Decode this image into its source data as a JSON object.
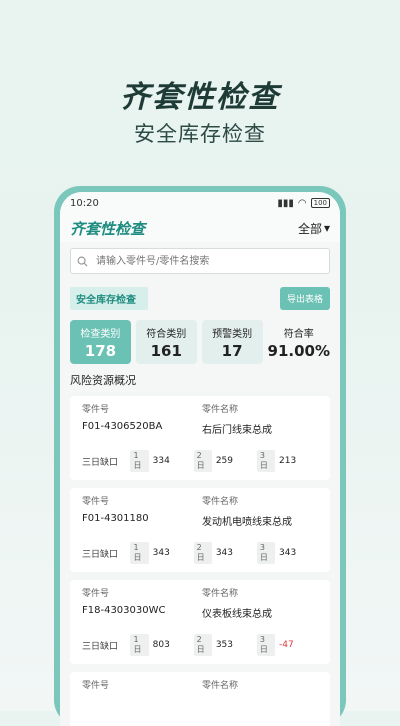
{
  "promo": {
    "title": "齐套性检查",
    "subtitle": "安全库存检查"
  },
  "status_bar": {
    "time": "10:20",
    "left_icons": "⚐ ⚐ ✱",
    "battery": "100"
  },
  "header": {
    "title": "齐套性检查",
    "filter": "全部"
  },
  "search": {
    "placeholder": "请输入零件号/零件名搜索"
  },
  "section": {
    "label": "安全库存检查",
    "export_label": "导出表格"
  },
  "stats": [
    {
      "label": "检查类别",
      "value": "178"
    },
    {
      "label": "符合类别",
      "value": "161"
    },
    {
      "label": "预警类别",
      "value": "17"
    },
    {
      "label": "符合率",
      "value": "91.00%"
    }
  ],
  "risk_title": "风险资源概况",
  "labels": {
    "part_no": "零件号",
    "part_name": "零件名称"
  },
  "cards": [
    {
      "part_no": "F01-4306520BA",
      "part_name": "右后门线束总成",
      "main": "三日缺口",
      "d1_tag": "1日",
      "d1": "334",
      "d2_tag": "2日",
      "d2": "259",
      "d3_tag": "3日",
      "d3": "213"
    },
    {
      "part_no": "F01-4301180",
      "part_name": "发动机电喷线束总成",
      "main": "三日缺口",
      "d1_tag": "1日",
      "d1": "343",
      "d2_tag": "2日",
      "d2": "343",
      "d3_tag": "3日",
      "d3": "343"
    },
    {
      "part_no": "F18-4303030WC",
      "part_name": "仪表板线束总成",
      "main": "三日缺口",
      "d1_tag": "1日",
      "d1": "803",
      "d2_tag": "2日",
      "d2": "353",
      "d3_tag": "3日",
      "d3": "-47"
    },
    {
      "part_no": "",
      "part_name": ""
    }
  ]
}
